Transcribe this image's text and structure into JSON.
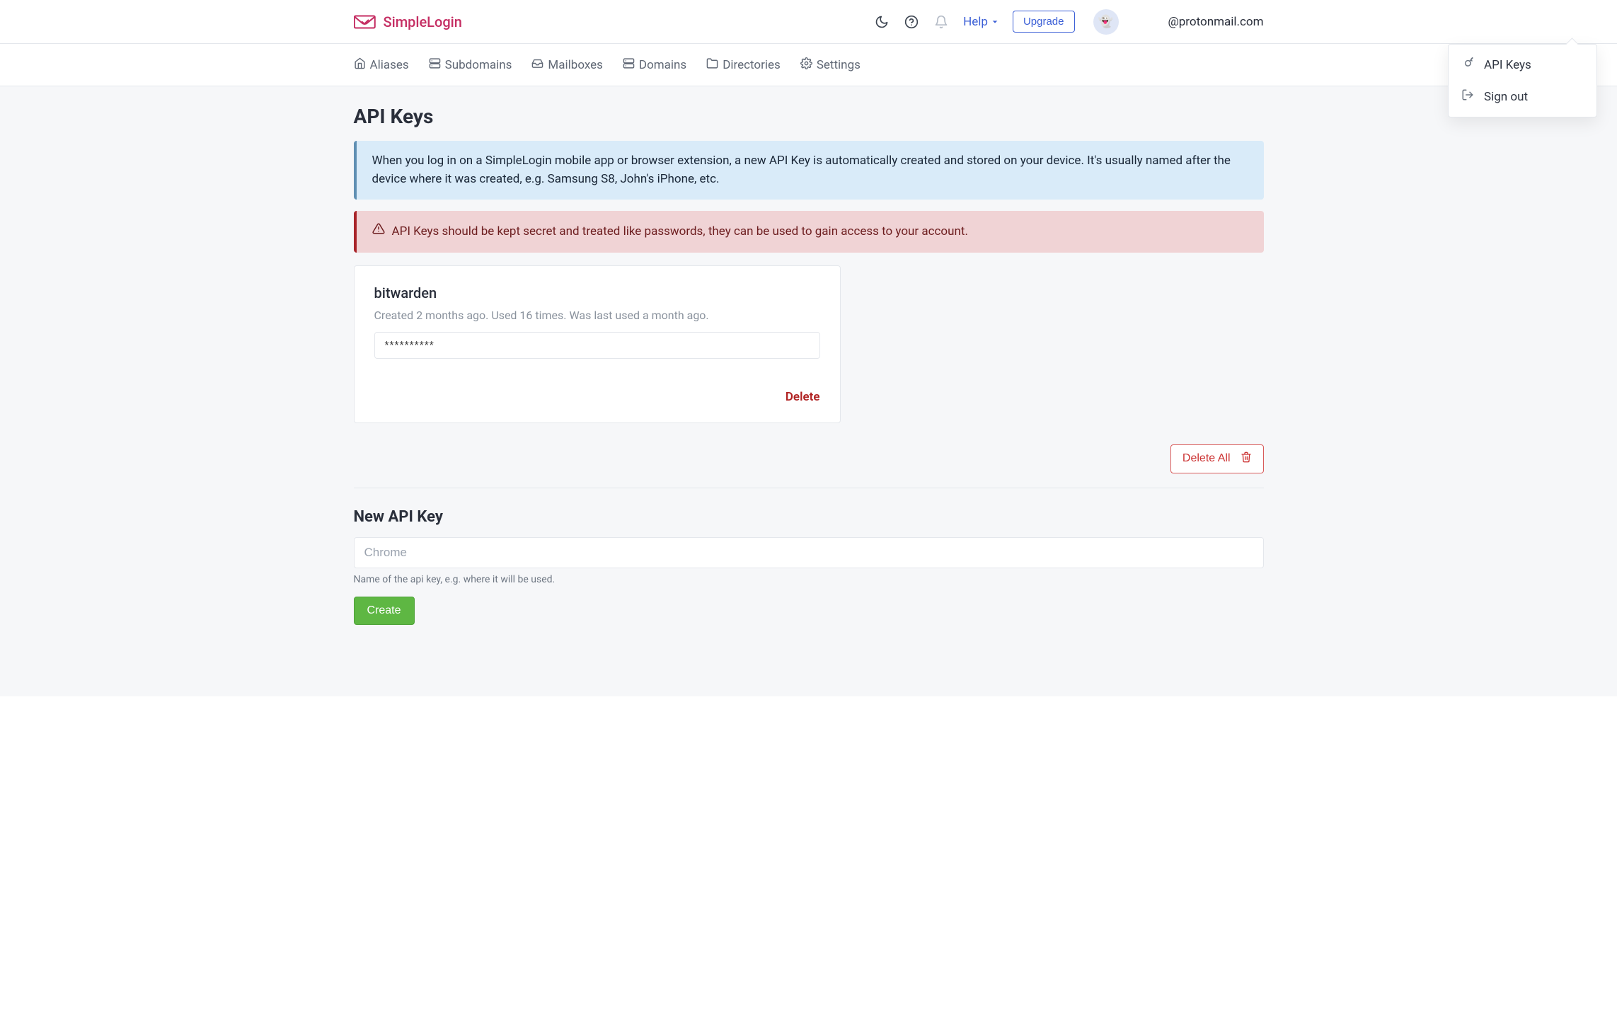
{
  "brand": {
    "name": "SimpleLogin"
  },
  "header": {
    "help_label": "Help",
    "upgrade_label": "Upgrade",
    "avatar_emoji": "👻",
    "user_email": "@protonmail.com"
  },
  "dropdown": {
    "api_keys": "API Keys",
    "sign_out": "Sign out"
  },
  "nav": {
    "aliases": "Aliases",
    "subdomains": "Subdomains",
    "mailboxes": "Mailboxes",
    "domains": "Domains",
    "directories": "Directories",
    "settings": "Settings"
  },
  "page": {
    "title": "API Keys",
    "info": "When you log in on a SimpleLogin mobile app or browser extension, a new API Key is automatically created and stored on your device. It's usually named after the device where it was created, e.g. Samsung S8, John's iPhone, etc.",
    "warning": "API Keys should be kept secret and treated like passwords, they can be used to gain access to your account."
  },
  "keys": [
    {
      "name": "bitwarden",
      "meta": "Created 2 months ago. Used 16 times. Was last used a month ago.",
      "masked": "**********",
      "delete_label": "Delete"
    }
  ],
  "actions": {
    "delete_all": "Delete All"
  },
  "new_key": {
    "title": "New API Key",
    "placeholder": "Chrome",
    "hint": "Name of the api key, e.g. where it will be used.",
    "create_label": "Create"
  }
}
